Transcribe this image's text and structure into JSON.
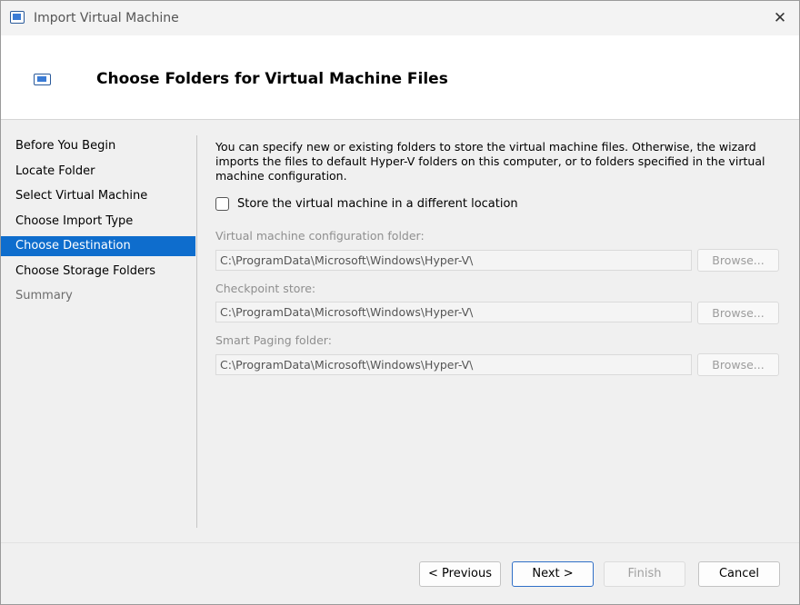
{
  "window": {
    "title": "Import Virtual Machine",
    "close_glyph": "✕"
  },
  "header": {
    "title": "Choose Folders for Virtual Machine Files",
    "icon": "import-vm-icon"
  },
  "steps": [
    {
      "label": "Before You Begin",
      "state": "normal"
    },
    {
      "label": "Locate Folder",
      "state": "normal"
    },
    {
      "label": "Select Virtual Machine",
      "state": "normal"
    },
    {
      "label": "Choose Import Type",
      "state": "normal"
    },
    {
      "label": "Choose Destination",
      "state": "active"
    },
    {
      "label": "Choose Storage Folders",
      "state": "normal"
    },
    {
      "label": "Summary",
      "state": "disabled"
    }
  ],
  "content": {
    "description": "You can specify new or existing folders to store the virtual machine files. Otherwise, the wizard imports the files to default Hyper-V folders on this computer, or to folders specified in the virtual machine configuration.",
    "checkbox_label": "Store the virtual machine in a different location",
    "checkbox_checked": false,
    "fields": [
      {
        "label": "Virtual machine configuration folder:",
        "value": "C:\\ProgramData\\Microsoft\\Windows\\Hyper-V\\",
        "browse": "Browse..."
      },
      {
        "label": "Checkpoint store:",
        "value": "C:\\ProgramData\\Microsoft\\Windows\\Hyper-V\\",
        "browse": "Browse..."
      },
      {
        "label": "Smart Paging folder:",
        "value": "C:\\ProgramData\\Microsoft\\Windows\\Hyper-V\\",
        "browse": "Browse..."
      }
    ]
  },
  "buttons": {
    "previous": "< Previous",
    "next": "Next >",
    "finish": "Finish",
    "cancel": "Cancel"
  },
  "colors": {
    "accent": "#0e6dcd",
    "disabled_text": "#8f8f8f"
  }
}
